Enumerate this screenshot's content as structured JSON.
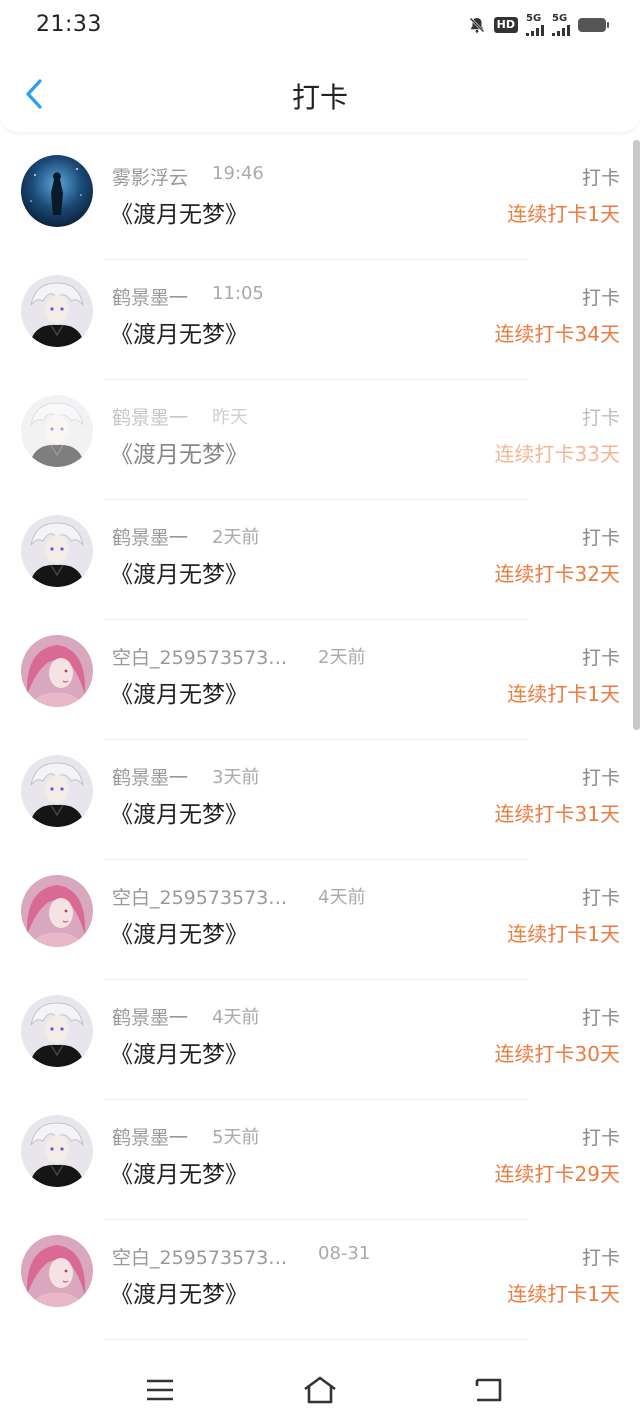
{
  "status_bar": {
    "time": "21:33",
    "hd_label": "HD",
    "sim1": "5G",
    "sim2": "5G"
  },
  "nav": {
    "title": "打卡",
    "back_icon": "chevron-left-icon",
    "accent_color": "#2a9df4"
  },
  "rows": [
    {
      "user": "雾影浮云",
      "time": "19:46",
      "title": "《渡月无梦》",
      "action": "打卡",
      "streak": "连续打卡1天",
      "avatar": "night-sky"
    },
    {
      "user": "鹤景墨一",
      "time": "11:05",
      "title": "《渡月无梦》",
      "action": "打卡",
      "streak": "连续打卡34天",
      "avatar": "white-hair"
    },
    {
      "user": "鹤景墨一",
      "time": "昨天",
      "title": "《渡月无梦》",
      "action": "打卡",
      "streak": "连续打卡33天",
      "avatar": "white-hair"
    },
    {
      "user": "鹤景墨一",
      "time": "2天前",
      "title": "《渡月无梦》",
      "action": "打卡",
      "streak": "连续打卡32天",
      "avatar": "white-hair"
    },
    {
      "user": "空白_259573573…",
      "time": "2天前",
      "title": "《渡月无梦》",
      "action": "打卡",
      "streak": "连续打卡1天",
      "avatar": "pink-hair"
    },
    {
      "user": "鹤景墨一",
      "time": "3天前",
      "title": "《渡月无梦》",
      "action": "打卡",
      "streak": "连续打卡31天",
      "avatar": "white-hair"
    },
    {
      "user": "空白_259573573…",
      "time": "4天前",
      "title": "《渡月无梦》",
      "action": "打卡",
      "streak": "连续打卡1天",
      "avatar": "pink-hair"
    },
    {
      "user": "鹤景墨一",
      "time": "4天前",
      "title": "《渡月无梦》",
      "action": "打卡",
      "streak": "连续打卡30天",
      "avatar": "white-hair"
    },
    {
      "user": "鹤景墨一",
      "time": "5天前",
      "title": "《渡月无梦》",
      "action": "打卡",
      "streak": "连续打卡29天",
      "avatar": "white-hair"
    },
    {
      "user": "空白_259573573…",
      "time": "08-31",
      "title": "《渡月无梦》",
      "action": "打卡",
      "streak": "连续打卡1天",
      "avatar": "pink-hair"
    }
  ],
  "colors": {
    "streak": "#ec7a3c",
    "username": "#999999",
    "title": "#222222"
  },
  "bottom_nav": {
    "menu_icon": "menu-icon",
    "home_icon": "home-icon",
    "back_icon": "return-icon"
  }
}
